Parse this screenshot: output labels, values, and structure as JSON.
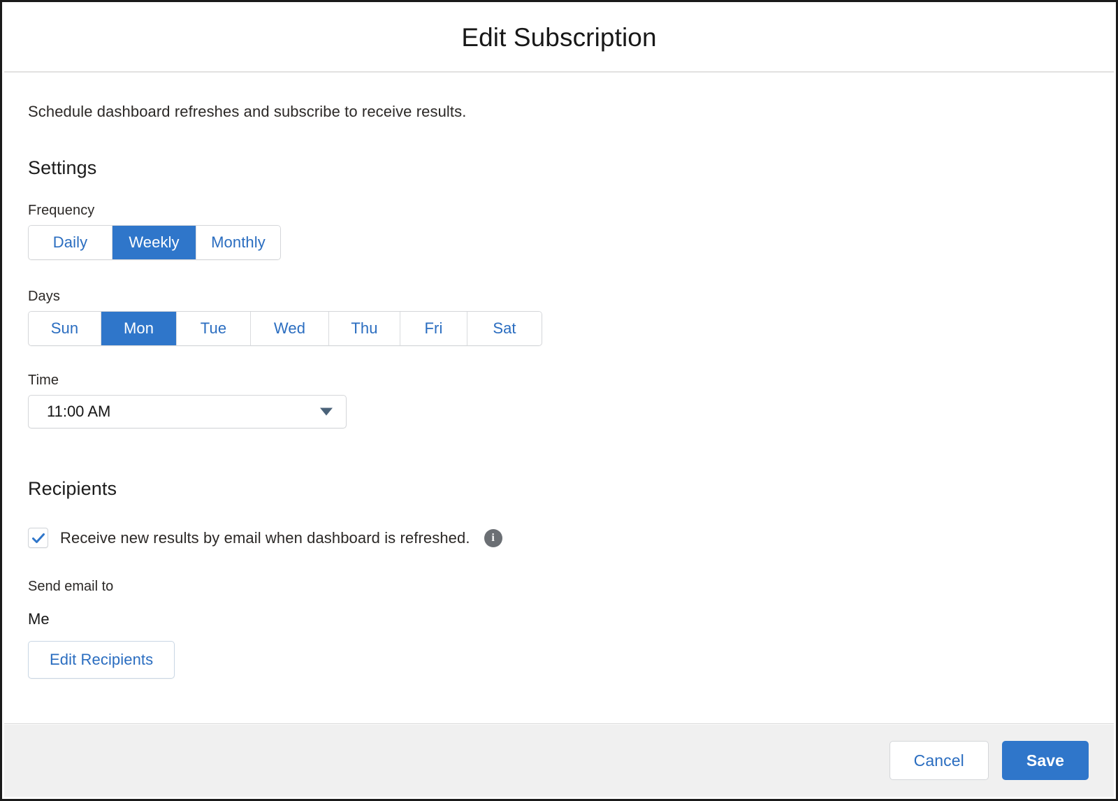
{
  "header": {
    "title": "Edit Subscription"
  },
  "body": {
    "intro": "Schedule dashboard refreshes and subscribe to receive results.",
    "settings": {
      "heading": "Settings",
      "frequency": {
        "label": "Frequency",
        "options": [
          "Daily",
          "Weekly",
          "Monthly"
        ],
        "selected": "Weekly"
      },
      "days": {
        "label": "Days",
        "options": [
          "Sun",
          "Mon",
          "Tue",
          "Wed",
          "Thu",
          "Fri",
          "Sat"
        ],
        "selected": "Mon"
      },
      "time": {
        "label": "Time",
        "value": "11:00 AM",
        "caret_icon": "chevron-down-icon"
      }
    },
    "recipients": {
      "heading": "Recipients",
      "email_checkbox": {
        "label": "Receive new results by email when dashboard is refreshed.",
        "checked": true,
        "info_icon": "info-icon",
        "info_glyph": "i"
      },
      "send_email_to_label": "Send email to",
      "send_email_to_value": "Me",
      "edit_recipients_label": "Edit Recipients"
    }
  },
  "footer": {
    "cancel_label": "Cancel",
    "save_label": "Save"
  },
  "colors": {
    "brand_blue": "#2f76ca",
    "link_blue": "#2a6dc0",
    "footer_bg": "#f0f0f0",
    "text_dark": "#2b2826",
    "info_gray": "#6b6f74"
  }
}
